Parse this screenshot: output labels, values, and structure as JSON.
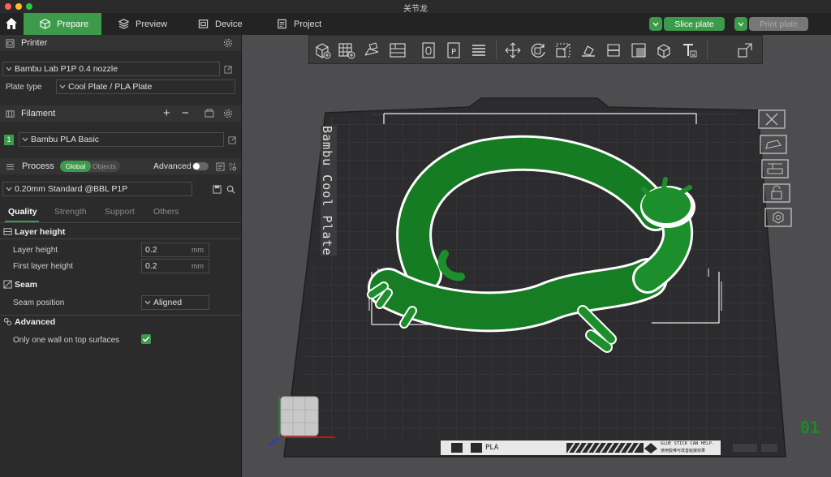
{
  "window": {
    "title": "关节龙"
  },
  "tabs": [
    {
      "label": "Prepare"
    },
    {
      "label": "Preview"
    },
    {
      "label": "Device"
    },
    {
      "label": "Project"
    }
  ],
  "actions": {
    "slice_label": "Slice plate",
    "print_label": "Print plate"
  },
  "printer": {
    "section_label": "Printer",
    "name": "Bambu Lab P1P 0.4 nozzle",
    "plate_type_label": "Plate type",
    "plate_type_value": "Cool Plate / PLA Plate"
  },
  "filament": {
    "section_label": "Filament",
    "slot_number": "1",
    "name": "Bambu PLA Basic",
    "color": "#3c9a4a"
  },
  "process": {
    "section_label": "Process",
    "global_label": "Global",
    "objects_label": "Objects",
    "advanced_label": "Advanced",
    "preset": "0.20mm Standard @BBL P1P",
    "subtabs": [
      "Quality",
      "Strength",
      "Support",
      "Others"
    ],
    "groups": {
      "layer_height": {
        "title": "Layer height",
        "layer_height_label": "Layer height",
        "layer_height_value": "0.2",
        "first_layer_height_label": "First layer height",
        "first_layer_height_value": "0.2",
        "unit": "mm"
      },
      "seam": {
        "title": "Seam",
        "seam_position_label": "Seam position",
        "seam_position_value": "Aligned"
      },
      "advanced": {
        "title": "Advanced",
        "one_wall_label": "Only one wall on top surfaces"
      }
    }
  },
  "plate": {
    "label": "Bambu Cool Plate",
    "filament_type": "PLA",
    "plate_number": "01",
    "notice_line1": "GLUE STICK CAN HELP.",
    "notice_line2": "使用胶棒可改善粘接效果"
  },
  "colors": {
    "accent": "#3c9a4a",
    "model": "#1c8f2c",
    "bed": "#2f2f31"
  }
}
